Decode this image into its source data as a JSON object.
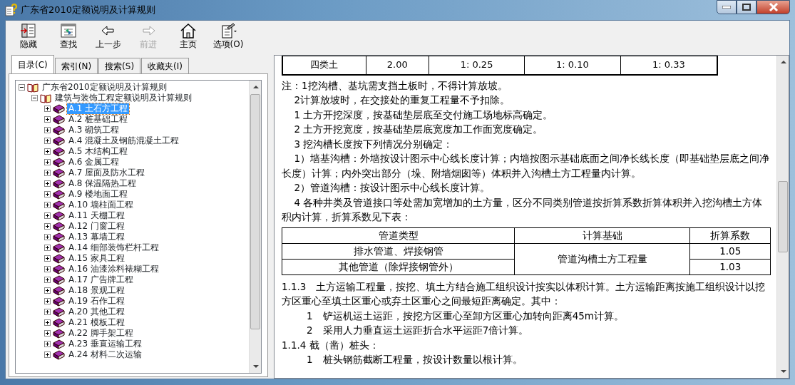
{
  "window": {
    "title": "广东省2010定额说明及计算规则"
  },
  "toolbar": [
    {
      "kind": "hide",
      "label": "隐藏",
      "disabled": false
    },
    {
      "kind": "find",
      "label": "查找",
      "disabled": false
    },
    {
      "kind": "back",
      "label": "上一步",
      "disabled": false
    },
    {
      "kind": "forward",
      "label": "前进",
      "disabled": true
    },
    {
      "kind": "home",
      "label": "主页",
      "disabled": false
    },
    {
      "kind": "options",
      "label": "选项(O)",
      "disabled": false
    }
  ],
  "tabs": [
    {
      "label": "目录(C)",
      "selected": true
    },
    {
      "label": "索引(N)",
      "selected": false
    },
    {
      "label": "搜索(S)",
      "selected": false
    },
    {
      "label": "收藏夹(I)",
      "selected": false
    }
  ],
  "tree": {
    "label": "广东省2010定额说明及计算规则",
    "expanded": true,
    "children": [
      {
        "label": "建筑与装饰工程定额说明及计算规则",
        "expanded": true,
        "children": [
          {
            "label": "A.1 土石方工程",
            "selected": true
          },
          {
            "label": "A.2 桩基础工程",
            "selected": false
          },
          {
            "label": "A.3 砌筑工程",
            "selected": false
          },
          {
            "label": "A.4 混凝土及钢筋混凝土工程",
            "selected": false
          },
          {
            "label": "A.5 木结构工程",
            "selected": false
          },
          {
            "label": "A.6 金属工程",
            "selected": false
          },
          {
            "label": "A.7 屋面及防水工程",
            "selected": false
          },
          {
            "label": "A.8 保温隔热工程",
            "selected": false
          },
          {
            "label": "A.9 楼地面工程",
            "selected": false
          },
          {
            "label": "A.10 墙柱面工程",
            "selected": false
          },
          {
            "label": "A.11 天棚工程",
            "selected": false
          },
          {
            "label": "A.12 门窗工程",
            "selected": false
          },
          {
            "label": "A.13 幕墙工程",
            "selected": false
          },
          {
            "label": "A.14 细部装饰栏杆工程",
            "selected": false
          },
          {
            "label": "A.15 家具工程",
            "selected": false
          },
          {
            "label": "A.16 油漆涂料裱糊工程",
            "selected": false
          },
          {
            "label": "A.17 广告牌工程",
            "selected": false
          },
          {
            "label": "A.18 景观工程",
            "selected": false
          },
          {
            "label": "A.19 石作工程",
            "selected": false
          },
          {
            "label": "A.20 其他工程",
            "selected": false
          },
          {
            "label": "A.21 模板工程",
            "selected": false
          },
          {
            "label": "A.22 脚手架工程",
            "selected": false
          },
          {
            "label": "A.23 垂直运输工程",
            "selected": false
          },
          {
            "label": "A.24 材料二次运输",
            "selected": false
          }
        ]
      }
    ]
  },
  "content": [
    {
      "kind": "table",
      "rows": [
        [
          "四类土",
          "2.00",
          "1: 0.25",
          "1: 0.10",
          "1: 0.33"
        ]
      ]
    },
    {
      "kind": "flush",
      "text": "注：1挖沟槽、基坑需支挡土板时，不得计算放坡。"
    },
    {
      "kind": "indent",
      "text": "2计算放坡时，在交接处的重复工程量不予扣除。"
    },
    {
      "kind": "indent",
      "text": "1 土方开挖深度，按基础垫层底至交付施工场地标高确定。"
    },
    {
      "kind": "indent",
      "text": "2 土方开挖宽度，按基础垫层底宽度加工作面宽度确定。"
    },
    {
      "kind": "indent",
      "text": "3 挖沟槽长度按下列情况分别确定："
    },
    {
      "kind": "indent",
      "text": "1）墙基沟槽：外墙按设计图示中心线长度计算；内墙按图示基础底面之间净长线长度（即基础垫层底之间净长度）计算；内外突出部分（垛、附墙烟囱等）体积并入沟槽土方工程量内计算。"
    },
    {
      "kind": "indent",
      "text": "2）管道沟槽：按设计图示中心线长度计算。"
    },
    {
      "kind": "indent",
      "text": "4 各种井类及管道接口等处需加宽增加的土方量，区分不同类别管道按折算系数折算体积并入挖沟槽土方体积内计算，折算系数见下表："
    },
    {
      "kind": "grid",
      "header": [
        "管道类型",
        "计算基础",
        "折算系数"
      ],
      "rows": [
        [
          "排水管道、焊接钢管",
          {
            "text": "管道沟槽土方工程量",
            "rowspan": 2
          },
          "1.05"
        ],
        [
          "其他管道（除焊接钢管外）",
          "1.03"
        ]
      ]
    },
    {
      "kind": "flush",
      "text": "1.1.3　土方运输工程量，按挖、填土方结合施工组织设计按实以体积计算。土方运输距离按施工组织设计以挖方区重心至填土区重心或弃土区重心之间最短距离确定。其中："
    },
    {
      "kind": "deep",
      "text": "1　铲运机运土运距，按挖方区重心至卸方区重心加转向距离45m计算。"
    },
    {
      "kind": "deep",
      "text": "2　采用人力垂直运土运距折合水平运距7倍计算。"
    },
    {
      "kind": "flush",
      "text": "1.1.4 截（凿）桩头："
    },
    {
      "kind": "deep",
      "text": "1　桩头钢筋截断工程量，按设计数量以根计算。"
    }
  ]
}
